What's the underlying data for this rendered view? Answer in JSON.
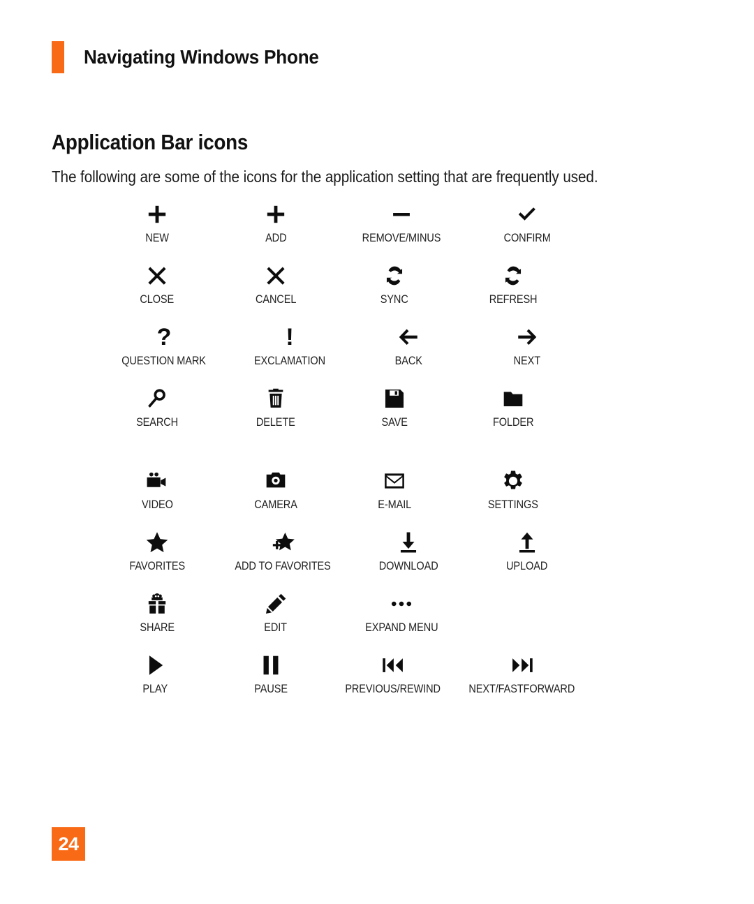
{
  "header": {
    "title": "Navigating Windows Phone",
    "accent_color": "#F96A16"
  },
  "section": {
    "title": "Application Bar icons",
    "intro": "The following are some of the icons for the application setting that are frequently used."
  },
  "footer": {
    "page_number": "24",
    "badge_color": "#F96A16",
    "badge_text_color": "#FFFFFF"
  },
  "icon_rows": [
    {
      "cells": [
        {
          "icon": "plus-icon",
          "label": "NEW"
        },
        {
          "icon": "plus-icon",
          "label": "ADD"
        },
        {
          "icon": "minus-icon",
          "label": "REMOVE/MINUS"
        },
        {
          "icon": "check-icon",
          "label": "CONFIRM"
        }
      ]
    },
    {
      "cells": [
        {
          "icon": "close-x-icon",
          "label": "CLOSE"
        },
        {
          "icon": "close-x-icon",
          "label": "CANCEL"
        },
        {
          "icon": "sync-icon",
          "label": "SYNC"
        },
        {
          "icon": "refresh-icon",
          "label": "REFRESH"
        }
      ]
    },
    {
      "cells": [
        {
          "icon": "question-mark-icon",
          "label": "QUESTION MARK"
        },
        {
          "icon": "exclamation-icon",
          "label": "EXCLAMATION"
        },
        {
          "icon": "arrow-left-icon",
          "label": "BACK"
        },
        {
          "icon": "arrow-right-icon",
          "label": "NEXT"
        }
      ]
    },
    {
      "cells": [
        {
          "icon": "search-icon",
          "label": "SEARCH"
        },
        {
          "icon": "trash-icon",
          "label": "DELETE"
        },
        {
          "icon": "floppy-save-icon",
          "label": "SAVE"
        },
        {
          "icon": "folder-icon",
          "label": "FOLDER"
        }
      ]
    },
    {
      "cells": [
        {
          "icon": "video-camera-icon",
          "label": "VIDEO"
        },
        {
          "icon": "camera-icon",
          "label": "CAMERA"
        },
        {
          "icon": "envelope-icon",
          "label": "E-MAIL"
        },
        {
          "icon": "gear-icon",
          "label": "SETTINGS"
        }
      ]
    },
    {
      "cells": [
        {
          "icon": "star-icon",
          "label": "FAVORITES"
        },
        {
          "icon": "star-plus-icon",
          "label": "ADD TO FAVORITES"
        },
        {
          "icon": "download-arrow-icon",
          "label": "DOWNLOAD"
        },
        {
          "icon": "upload-arrow-icon",
          "label": "UPLOAD"
        }
      ]
    },
    {
      "cells": [
        {
          "icon": "gift-icon",
          "label": "SHARE"
        },
        {
          "icon": "pencil-icon",
          "label": "EDIT"
        },
        {
          "icon": "ellipsis-icon",
          "label": "EXPAND MENU"
        }
      ]
    },
    {
      "cells": [
        {
          "icon": "play-icon",
          "label": "PLAY"
        },
        {
          "icon": "pause-icon",
          "label": "PAUSE"
        },
        {
          "icon": "previous-rewind-icon",
          "label": "PREVIOUS/REWIND"
        },
        {
          "icon": "next-fastforward-icon",
          "label": "NEXT/FASTFORWARD"
        }
      ]
    }
  ]
}
